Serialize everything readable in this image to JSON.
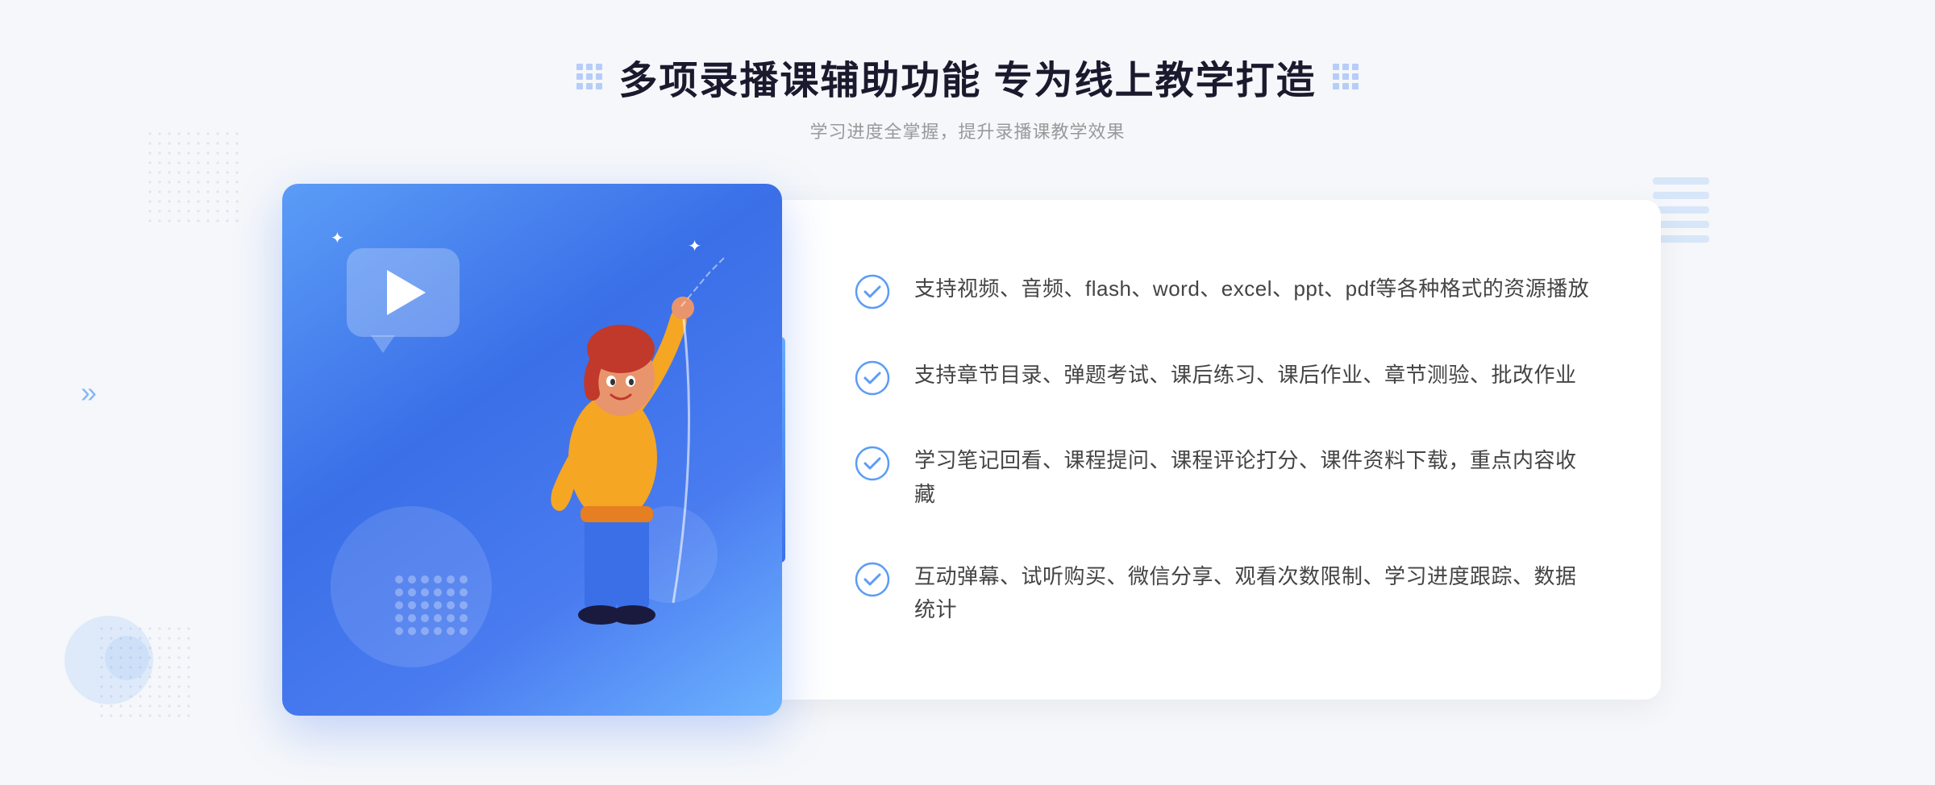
{
  "header": {
    "main_title": "多项录播课辅助功能 专为线上教学打造",
    "subtitle": "学习进度全掌握，提升录播课教学效果"
  },
  "features": [
    {
      "id": 1,
      "text": "支持视频、音频、flash、word、excel、ppt、pdf等各种格式的资源播放"
    },
    {
      "id": 2,
      "text": "支持章节目录、弹题考试、课后练习、课后作业、章节测验、批改作业"
    },
    {
      "id": 3,
      "text": "学习笔记回看、课程提问、课程评论打分、课件资料下载，重点内容收藏"
    },
    {
      "id": 4,
      "text": "互动弹幕、试听购买、微信分享、观看次数限制、学习进度跟踪、数据统计"
    }
  ],
  "colors": {
    "primary": "#3a6fe8",
    "primary_light": "#5b9cf6",
    "accent": "#6db3ff",
    "text_dark": "#1a1a2e",
    "text_gray": "#444",
    "text_light": "#999",
    "bg": "#f5f7fa"
  },
  "icons": {
    "grid_icon": "⠿",
    "check_icon": "check-circle",
    "play_icon": "▶",
    "chevron": "»"
  }
}
